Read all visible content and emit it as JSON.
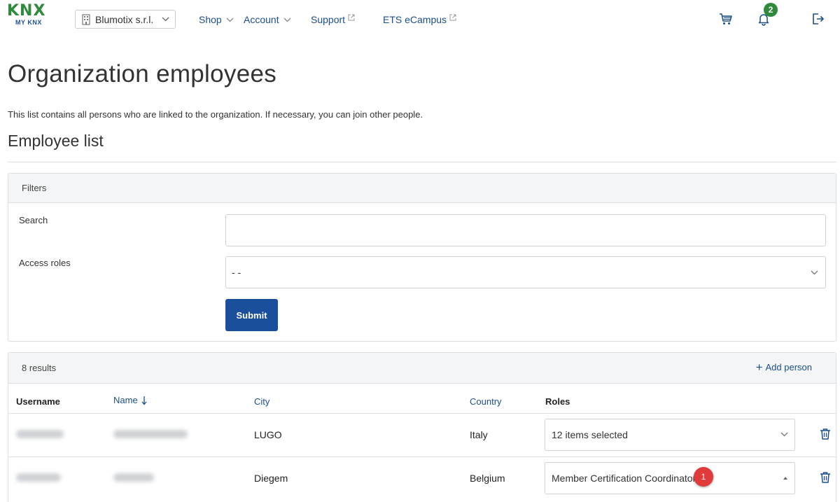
{
  "header": {
    "logo_text": "KNX",
    "logo_sub": "MY KNX",
    "organization": "Blumotix s.r.l.",
    "nav": {
      "shop": "Shop",
      "account": "Account",
      "support": "Support",
      "ets_ecampus": "ETS eCampus"
    },
    "notification_count": "2"
  },
  "page": {
    "title": "Organization employees",
    "intro": "This list contains all persons who are linked to the organization. If necessary, you can join other people.",
    "section_title": "Employee list"
  },
  "filters": {
    "title": "Filters",
    "search_label": "Search",
    "search_value": "",
    "access_roles_label": "Access roles",
    "access_roles_value": "- -",
    "submit_label": "Submit"
  },
  "results": {
    "count": "8 results",
    "add_person": "Add person",
    "columns": {
      "username": "Username",
      "name": "Name",
      "city": "City",
      "country": "Country",
      "roles": "Roles"
    },
    "rows": [
      {
        "city": "LUGO",
        "country": "Italy",
        "roles": "12 items selected"
      },
      {
        "city": "Diegem",
        "country": "Belgium",
        "roles": "Member Certification Coordinator"
      }
    ],
    "marker": "1"
  },
  "colors": {
    "brand_blue": "#1a4f9c",
    "brand_green": "#2f8a3c",
    "marker_red": "#e03a3a"
  }
}
